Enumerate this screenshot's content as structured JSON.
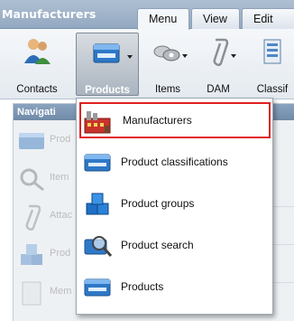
{
  "app": {
    "title": "Manufacturers"
  },
  "tabs": [
    {
      "label": "Menu",
      "active": true
    },
    {
      "label": "View",
      "active": false
    },
    {
      "label": "Edit",
      "active": false
    }
  ],
  "ribbon": {
    "buttons": [
      {
        "label": "Contacts",
        "icon": "contacts-icon"
      },
      {
        "label": "Products",
        "icon": "products-icon",
        "pressed": true
      },
      {
        "label": "Items",
        "icon": "items-icon"
      },
      {
        "label": "DAM",
        "icon": "dam-icon"
      },
      {
        "label": "Classif",
        "icon": "classifications-icon"
      }
    ]
  },
  "navigation": {
    "title": "Navigati",
    "items": [
      {
        "label": "Prod",
        "icon": "products-icon"
      },
      {
        "label": "Item",
        "icon": "item-search-icon"
      },
      {
        "label": "Attac",
        "icon": "attachment-icon"
      },
      {
        "label": "Prod",
        "icon": "product-groups-icon"
      },
      {
        "label": "Mem",
        "icon": "member-icon"
      }
    ]
  },
  "dropdown": {
    "items": [
      {
        "label": "Manufacturers",
        "icon": "factory-icon",
        "highlighted": true
      },
      {
        "label": "Product classifications",
        "icon": "product-classifications-icon"
      },
      {
        "label": "Product groups",
        "icon": "product-groups-icon"
      },
      {
        "label": "Product search",
        "icon": "product-search-icon"
      },
      {
        "label": "Products",
        "icon": "products-icon"
      }
    ]
  },
  "colors": {
    "title_bar": "#9fb3c8",
    "highlight_border": "#e02020",
    "pressed_button": "#aab4bf",
    "nav_header": "#7a94b2"
  }
}
